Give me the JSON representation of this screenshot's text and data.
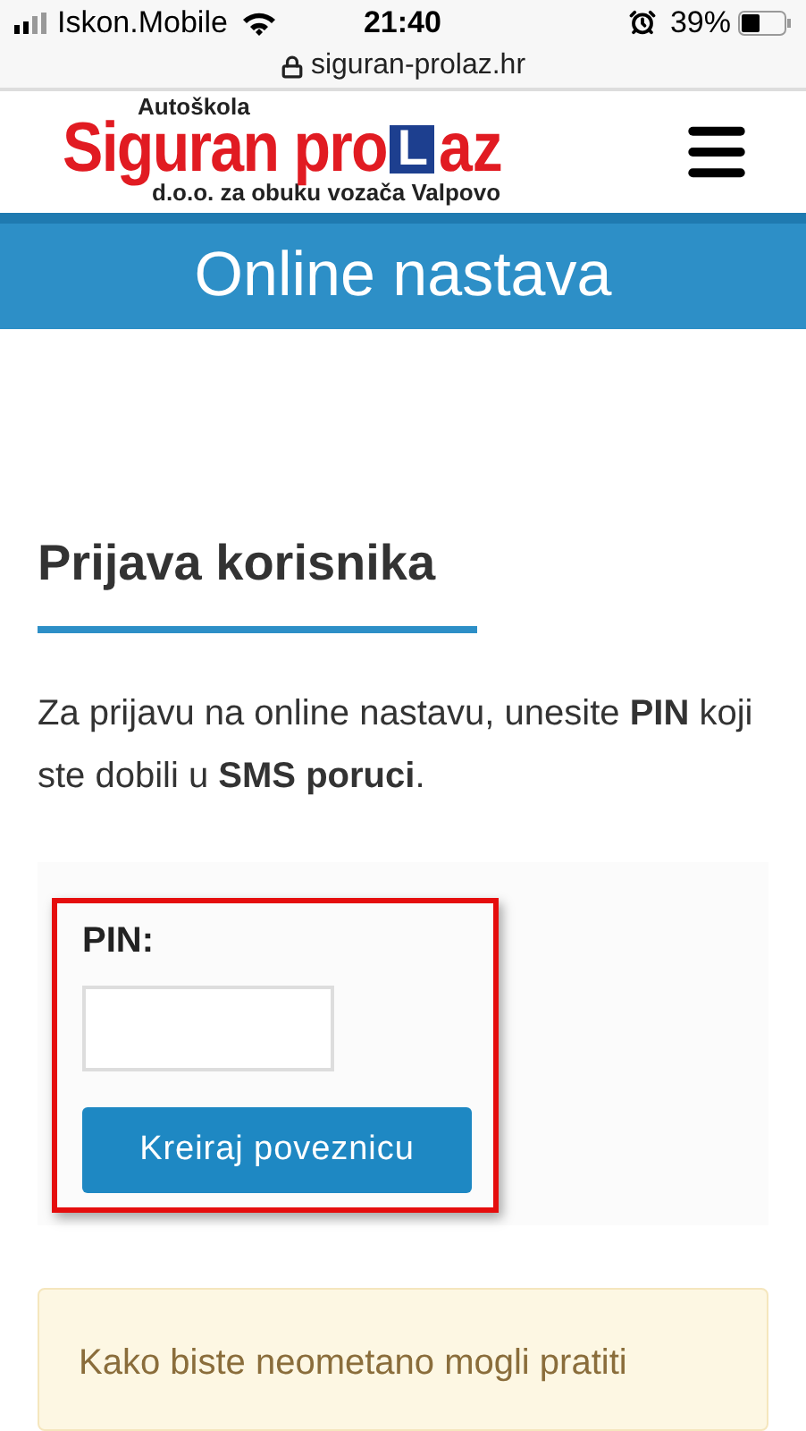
{
  "status_bar": {
    "carrier": "Iskon.Mobile",
    "time": "21:40",
    "battery": "39%"
  },
  "address_bar": {
    "url": "siguran-prolaz.hr"
  },
  "logo": {
    "top": "Autoškola",
    "main": "Siguran pro",
    "letter": "L",
    "end": "az",
    "sub": "d.o.o. za obuku vozača Valpovo"
  },
  "banner": {
    "title": "Online nastava"
  },
  "login": {
    "heading": "Prijava korisnika",
    "intro": "Za prijavu na online nastavu, unesite **PIN** koji ste dobili u **SMS poruci**.",
    "pin_label": "PIN:",
    "button": "Kreiraj poveznicu"
  },
  "notice": {
    "text": "Kako biste neometano mogli pratiti"
  }
}
